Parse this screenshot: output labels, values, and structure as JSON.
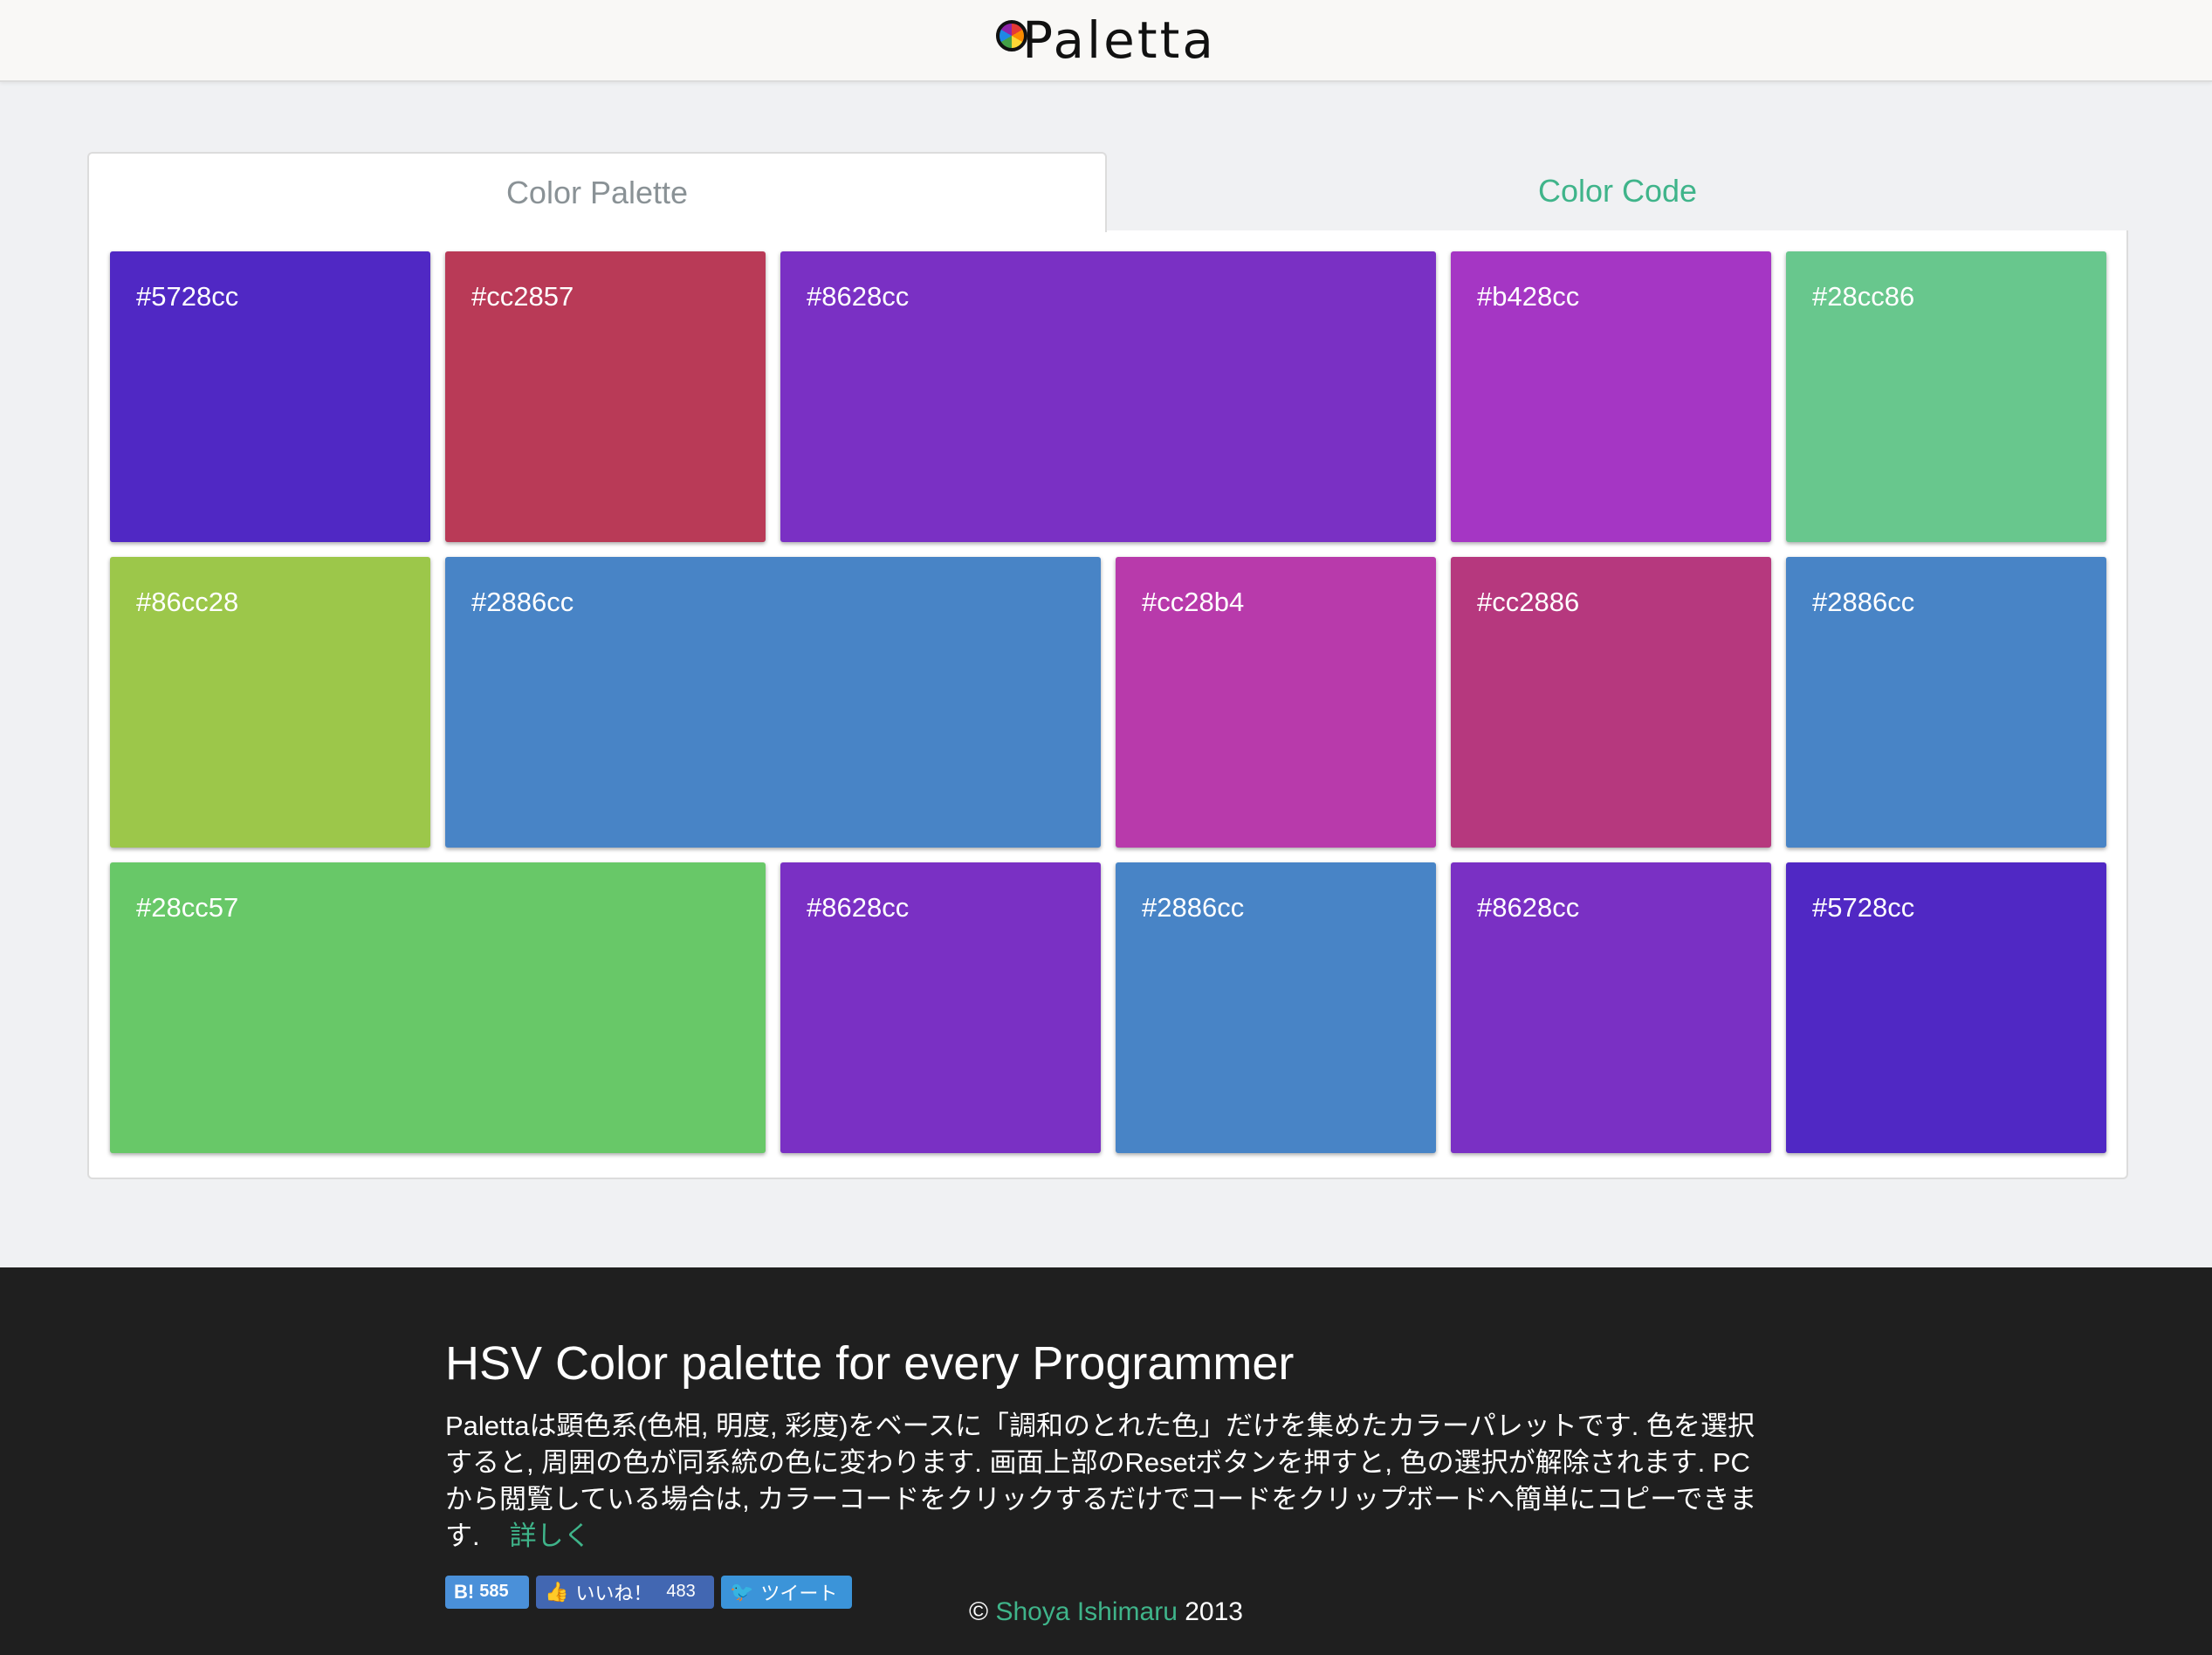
{
  "header": {
    "logo_text": "Paletta"
  },
  "tabs": [
    {
      "label": "Color Palette",
      "active": true
    },
    {
      "label": "Color Code",
      "active": false
    }
  ],
  "swatches": [
    {
      "code": "#5728cc",
      "color": "#5028c4"
    },
    {
      "code": "#cc2857",
      "color": "#b93a57"
    },
    {
      "code": "#8628cc",
      "color": "#7a30c4"
    },
    {
      "code": "#b428cc",
      "color": "#a536c4"
    },
    {
      "code": "#28cc86",
      "color": "#68c78d"
    },
    {
      "code": "#86cc28",
      "color": "#9cc74a"
    },
    {
      "code": "#2886cc",
      "color": "#4884c6"
    },
    {
      "code": "#cc28b4",
      "color": "#b83aab"
    },
    {
      "code": "#cc2886",
      "color": "#b6387e"
    },
    {
      "code": "#2886cc",
      "color": "#4884c6"
    },
    {
      "code": "#28cc57",
      "color": "#68c868"
    },
    {
      "code": "#8628cc",
      "color": "#7a30c4"
    },
    {
      "code": "#2886cc",
      "color": "#4884c6"
    },
    {
      "code": "#8628cc",
      "color": "#7a30c4"
    },
    {
      "code": "#5728cc",
      "color": "#5028c4"
    }
  ],
  "footer": {
    "title": "HSV Color palette for every Programmer",
    "description": "Palettaは顕色系(色相, 明度, 彩度)をベースに「調和のとれた色」だけを集めたカラーパレットです. 色を選択すると, 周囲の色が同系統の色に変わります. 画面上部のResetボタンを押すと, 色の選択が解除されます. PCから閲覧している場合は, カラーコードをクリックするだけでコードをクリップボードへ簡単にコピーできます.",
    "more_link": "詳しく",
    "share": {
      "hatena_label": "B!",
      "hatena_count": "585",
      "like_label": "いいね！",
      "like_count": "483",
      "tweet_label": "ツイート"
    },
    "copyright_prefix": "©",
    "author": "Shoya Ishimaru",
    "year": "2013"
  },
  "colors": {
    "accent": "#3fb48a",
    "footer_bg": "#1f1f1f",
    "page_bg": "#f0f1f3"
  }
}
